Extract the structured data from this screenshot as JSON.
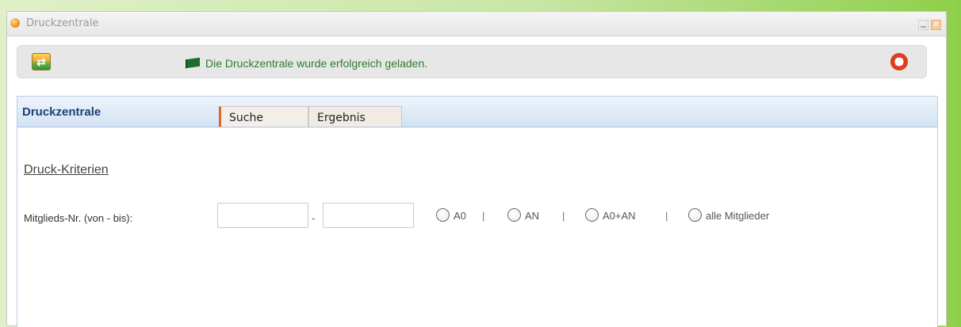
{
  "window": {
    "title": "Druckzentrale"
  },
  "toolbar": {
    "status_message": "Die Druckzentrale wurde erfolgreich geladen.",
    "icons": {
      "refresh": "refresh-icon",
      "status": "flag-icon",
      "help": "lifebuoy-icon"
    }
  },
  "panel": {
    "title": "Druckzentrale",
    "tabs": [
      {
        "label": "Suche"
      },
      {
        "label": "Ergebnis"
      }
    ]
  },
  "form": {
    "section_title": "Druck-Kriterien",
    "member_range": {
      "label": "Mitglieds-Nr. (von - bis):",
      "from_value": "",
      "separator": "-",
      "to_value": ""
    },
    "options": [
      {
        "label": "A0"
      },
      {
        "label": "AN"
      },
      {
        "label": "A0+AN"
      },
      {
        "label": "alle Mitglieder"
      }
    ],
    "option_separator": "|"
  },
  "colors": {
    "status_text": "#2e7d2e",
    "panel_title": "#1f3f7a",
    "active_tab_marker": "#e0642a"
  }
}
